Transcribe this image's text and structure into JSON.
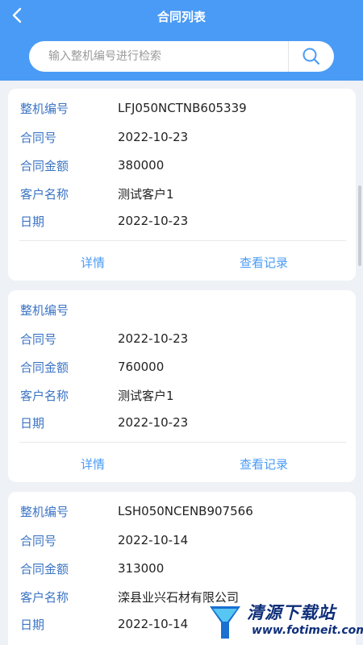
{
  "header": {
    "title": "合同列表",
    "back_icon": "chevron-left-icon"
  },
  "search": {
    "placeholder": "输入整机编号进行检索",
    "value": "",
    "icon": "search-icon"
  },
  "cards": [
    {
      "rows": [
        {
          "label": "整机编号",
          "value": "LFJ050NCTNB605339"
        },
        {
          "label": "合同号",
          "value": "2022-10-23"
        },
        {
          "label": "合同金额",
          "value": "380000"
        },
        {
          "label": "客户名称",
          "value": "测试客户1"
        },
        {
          "label": "日期",
          "value": "2022-10-23"
        }
      ],
      "actions": {
        "detail": "详情",
        "records": "查看记录"
      }
    },
    {
      "rows": [
        {
          "label": "整机编号",
          "value": ""
        },
        {
          "label": "合同号",
          "value": "2022-10-23"
        },
        {
          "label": "合同金额",
          "value": "760000"
        },
        {
          "label": "客户名称",
          "value": "测试客户1"
        },
        {
          "label": "日期",
          "value": "2022-10-23"
        }
      ],
      "actions": {
        "detail": "详情",
        "records": "查看记录"
      }
    },
    {
      "rows": [
        {
          "label": "整机编号",
          "value": "LSH050NCENB907566"
        },
        {
          "label": "合同号",
          "value": "2022-10-14"
        },
        {
          "label": "合同金额",
          "value": "313000"
        },
        {
          "label": "客户名称",
          "value": "滦县业兴石材有限公司"
        },
        {
          "label": "日期",
          "value": "2022-10-14"
        }
      ]
    }
  ],
  "watermark": {
    "name": "清源下载站",
    "url": "www.fotimeit.com"
  },
  "colors": {
    "primary": "#4a9bf5",
    "label": "#3b74c4",
    "background": "#eef1f5"
  }
}
